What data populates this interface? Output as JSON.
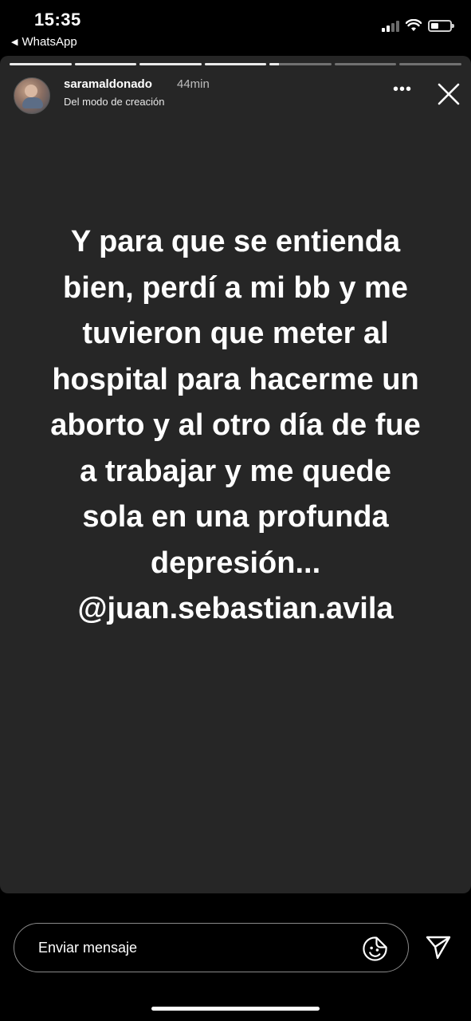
{
  "status_bar": {
    "time": "15:35",
    "back_app": "WhatsApp",
    "back_icon": "back-triangle-icon",
    "icons": [
      "signal-icon",
      "wifi-icon",
      "battery-icon"
    ]
  },
  "story": {
    "progress": {
      "segments": 7,
      "current_segment": 5,
      "current_fraction": 0.15
    },
    "user": {
      "username": "saramaldonado",
      "time_ago": "44min",
      "subtitle": "Del modo de creación"
    },
    "actions": {
      "more_icon": "more-icon",
      "close_icon": "close-icon"
    },
    "text_lines": [
      "Y para que se entienda",
      "bien,  perdí a mi bb y me",
      "tuvieron que meter al",
      "hospital para hacerme un",
      "aborto y al otro día de fue",
      "a trabajar y me quede",
      "sola en una profunda",
      "depresión...",
      "@juan.sebastian.avila"
    ]
  },
  "reply": {
    "placeholder": "Enviar mensaje",
    "sticker_icon": "sticker-icon",
    "send_icon": "send-icon"
  },
  "colors": {
    "background": "#000000",
    "story_background": "#262626",
    "text": "#ffffff"
  }
}
